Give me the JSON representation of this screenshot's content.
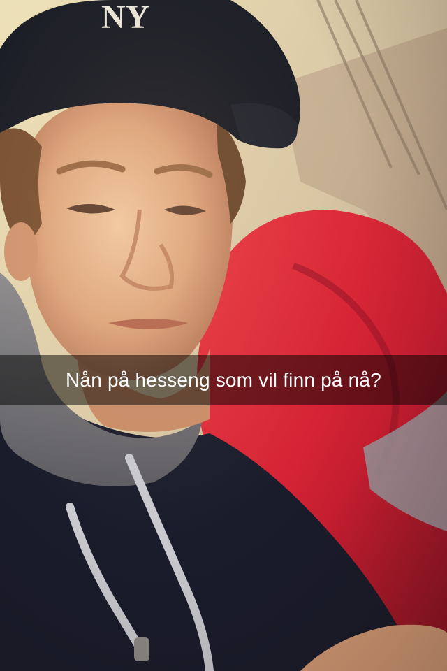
{
  "snap": {
    "caption": "Nån på hesseng som vil finn på nå?"
  },
  "colors": {
    "caption_bar": "rgba(0,0,0,0.5)",
    "caption_text": "#ffffff",
    "cap": "#1b1d26",
    "jacket": "#d9273a",
    "hoodie": "#1a1c2b"
  }
}
